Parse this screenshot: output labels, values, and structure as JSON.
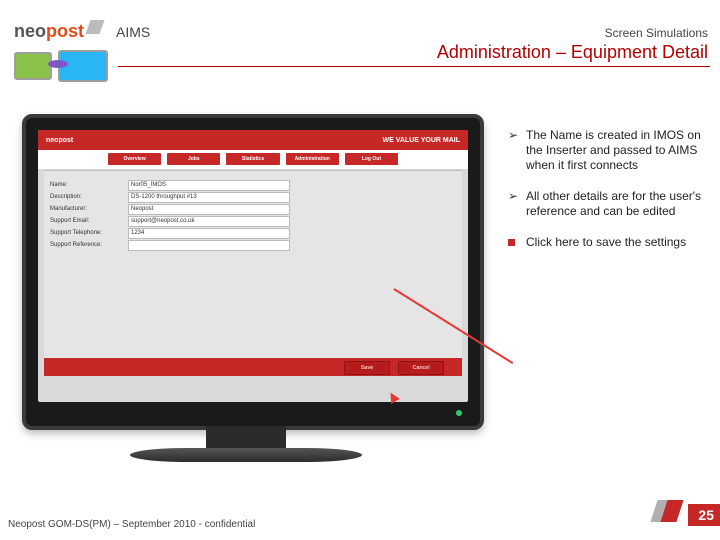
{
  "header": {
    "brand_a": "neo",
    "brand_b": "post",
    "aims": "AIMS",
    "screen_sim": "Screen Simulations",
    "title": "Administration – Equipment Detail"
  },
  "bullets": [
    {
      "glyph": "➢",
      "text": "The Name is created in IMOS on the Inserter and passed to AIMS when it first connects"
    },
    {
      "glyph": "➢",
      "text": "All other details are for the user's reference and can be edited"
    },
    {
      "glyph": "square",
      "text": "Click here to save the settings"
    }
  ],
  "app": {
    "logo": "neopost",
    "tagline": "WE VALUE YOUR MAIL",
    "tabs": [
      "Overview",
      "Jobs",
      "Statistics",
      "Administration",
      "Log Out"
    ],
    "fields": [
      {
        "label": "Name:",
        "value": "Nor05_IMOS"
      },
      {
        "label": "Description:",
        "value": "DS-1200 throughput #13"
      },
      {
        "label": "Manufacturer:",
        "value": "Neopost"
      },
      {
        "label": "Support Email:",
        "value": "support@neopost.co.uk"
      },
      {
        "label": "Support Telephone:",
        "value": "1234"
      },
      {
        "label": "Support Reference:",
        "value": ""
      }
    ],
    "save": "Save",
    "cancel": "Cancel"
  },
  "footer": {
    "confidential": "Neopost GOM-DS(PM) – September 2010 - confidential",
    "page": "25"
  }
}
